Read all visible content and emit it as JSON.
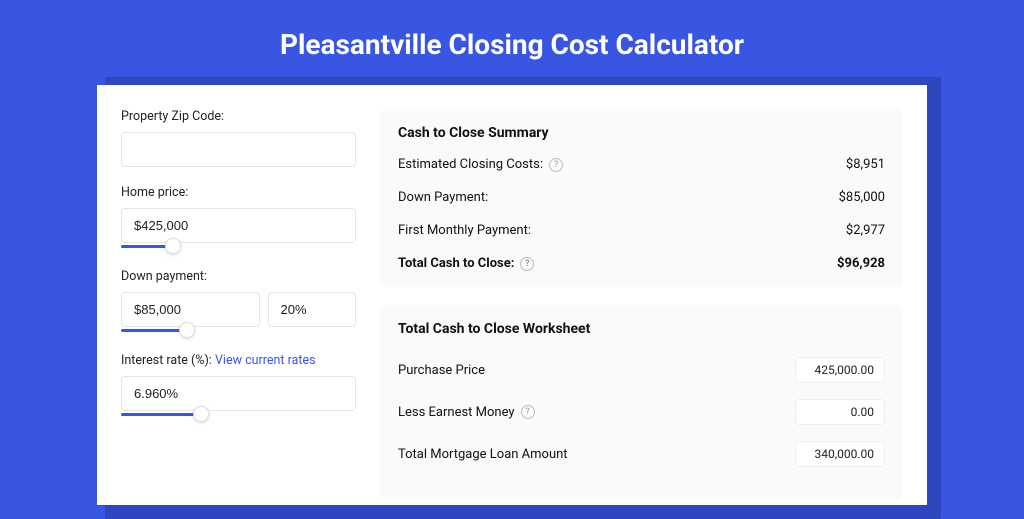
{
  "title": "Pleasantville Closing Cost Calculator",
  "form": {
    "zip": {
      "label": "Property Zip Code:",
      "value": ""
    },
    "home_price": {
      "label": "Home price:",
      "value": "$425,000",
      "slider_pct": 22
    },
    "down_payment": {
      "label": "Down payment:",
      "value": "$85,000",
      "pct_value": "20%",
      "slider_pct": 28
    },
    "interest_rate": {
      "label": "Interest rate (%):",
      "link": "View current rates",
      "value": "6.960%",
      "slider_pct": 34
    }
  },
  "summary": {
    "heading": "Cash to Close Summary",
    "rows": [
      {
        "label": "Estimated Closing Costs:",
        "help": true,
        "value": "$8,951",
        "bold": false
      },
      {
        "label": "Down Payment:",
        "help": false,
        "value": "$85,000",
        "bold": false
      },
      {
        "label": "First Monthly Payment:",
        "help": false,
        "value": "$2,977",
        "bold": false
      },
      {
        "label": "Total Cash to Close:",
        "help": true,
        "value": "$96,928",
        "bold": true
      }
    ]
  },
  "worksheet": {
    "heading": "Total Cash to Close Worksheet",
    "rows": [
      {
        "label": "Purchase Price",
        "help": false,
        "value": "425,000.00"
      },
      {
        "label": "Less Earnest Money",
        "help": true,
        "value": "0.00"
      },
      {
        "label": "Total Mortgage Loan Amount",
        "help": false,
        "value": "340,000.00"
      }
    ]
  }
}
